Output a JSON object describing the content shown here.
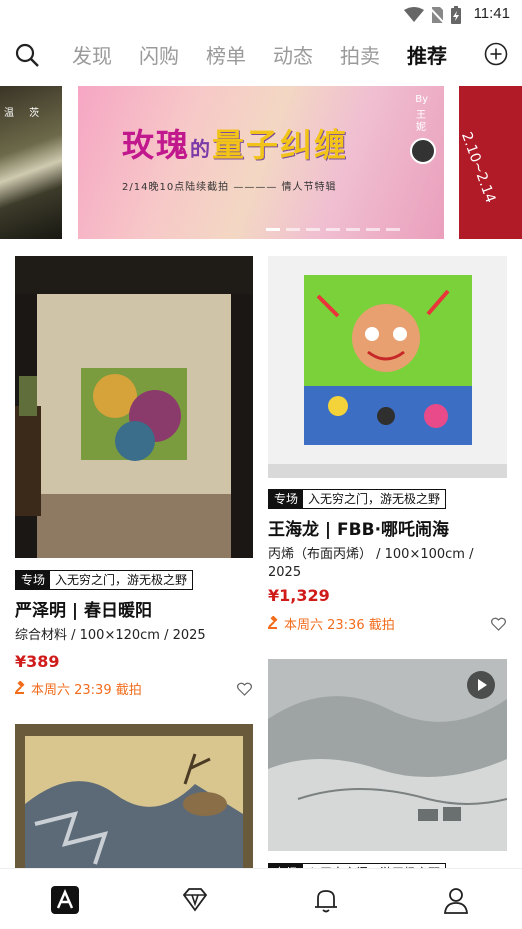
{
  "status_bar": {
    "time": "11:41"
  },
  "tabs": [
    {
      "label": "发现",
      "active": false
    },
    {
      "label": "闪购",
      "active": false
    },
    {
      "label": "榜单",
      "active": false
    },
    {
      "label": "动态",
      "active": false
    },
    {
      "label": "拍卖",
      "active": false
    },
    {
      "label": "推荐",
      "active": true
    }
  ],
  "banner": {
    "left_text": "温 茨",
    "title_a": "玫瑰",
    "title_b": "的",
    "title_c": "量子纠缠",
    "subtitle": "2/14晚10点陆续截拍 ———— 情人节特辑",
    "by": "By",
    "author": "王妮",
    "right_date": "2.10~2.14"
  },
  "cards": [
    {
      "tag_label": "专场",
      "tag_value": "入无穷之门，游无极之野",
      "name": "严泽明 | 春日暖阳",
      "meta": "综合材料 / 100×120cm / 2025",
      "price": "¥389",
      "deadline": "本周六 23:39 截拍"
    },
    {
      "tag_label": "专场",
      "tag_value": "入无穷之门，游无极之野",
      "name": "王海龙 | FBB·哪吒闹海",
      "meta": "丙烯（布面丙烯） / 100×100cm / 2025",
      "price": "¥1,329",
      "deadline": "本周六 23:36 截拍"
    },
    {
      "tag_label": "专场",
      "tag_value": "入无穷之门，游无极之野"
    }
  ],
  "colors": {
    "price": "#d01b1b",
    "deadline": "#f26c1c",
    "tab_active": "#111111",
    "tab_inactive": "#9a9a9a"
  }
}
